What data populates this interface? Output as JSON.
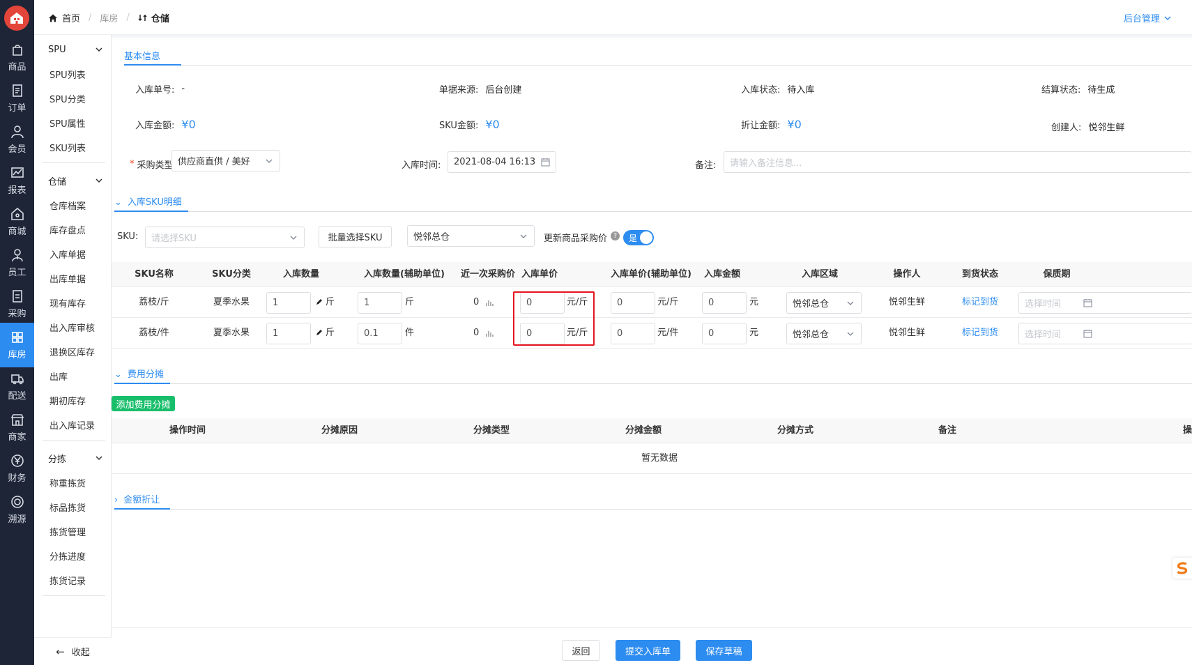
{
  "rail": [
    {
      "label": "商品",
      "icon": "bag-icon"
    },
    {
      "label": "订单",
      "icon": "order-icon"
    },
    {
      "label": "会员",
      "icon": "user-icon"
    },
    {
      "label": "报表",
      "icon": "chart-icon"
    },
    {
      "label": "商城",
      "icon": "home-icon"
    },
    {
      "label": "员工",
      "icon": "staff-icon"
    },
    {
      "label": "采购",
      "icon": "purchase-icon"
    },
    {
      "label": "库房",
      "icon": "warehouse-icon"
    },
    {
      "label": "配送",
      "icon": "truck-icon"
    },
    {
      "label": "商家",
      "icon": "shop-icon"
    },
    {
      "label": "财务",
      "icon": "yuan-icon"
    },
    {
      "label": "溯源",
      "icon": "trace-icon"
    }
  ],
  "submenu": {
    "groups": [
      {
        "label": "SPU",
        "items": [
          "SPU列表",
          "SPU分类",
          "SPU属性",
          "SKU列表"
        ]
      },
      {
        "label": "仓储",
        "items": [
          "仓库档案",
          "库存盘点",
          "入库单据",
          "出库单据",
          "现有库存",
          "出入库审核",
          "退换区库存",
          "出库",
          "期初库存",
          "出入库记录"
        ]
      },
      {
        "label": "分拣",
        "items": [
          "称重拣货",
          "标品拣货",
          "拣货管理",
          "分拣进度",
          "拣货记录"
        ]
      }
    ],
    "collapse": "收起"
  },
  "breadcrumb": {
    "home": "首页",
    "mid": "库房",
    "current": "仓储"
  },
  "admin": "后台管理",
  "basic": {
    "tab": "基本信息",
    "fields": {
      "order_no": {
        "label": "入库单号:",
        "value": "-"
      },
      "source": {
        "label": "单据来源:",
        "value": "后台创建"
      },
      "status": {
        "label": "入库状态:",
        "value": "待入库"
      },
      "settle": {
        "label": "结算状态:",
        "value": "待生成"
      },
      "amount": {
        "label": "入库金额:",
        "value": "¥0"
      },
      "sku_amount": {
        "label": "SKU金额:",
        "value": "¥0"
      },
      "discount": {
        "label": "折让金额:",
        "value": "¥0"
      },
      "creator": {
        "label": "创建人:",
        "value": "悦邻生鲜"
      },
      "purchase_type": {
        "label": "采购类型:",
        "value": "供应商直供 / 美好"
      },
      "in_time": {
        "label": "入库时间:",
        "value": "2021-08-04 16:13"
      },
      "remark": {
        "label": "备注:",
        "placeholder": "请输入备注信息..."
      }
    }
  },
  "sku": {
    "tab": "入库SKU明细",
    "label": "SKU:",
    "placeholder": "请选择SKU",
    "batch_btn": "批量选择SKU",
    "warehouse": "悦邻总仓",
    "update_price": "更新商品采购价",
    "switch": "是",
    "headers": [
      "SKU名称",
      "SKU分类",
      "入库数量",
      "入库数量(辅助单位)",
      "近一次采购价",
      "入库单价",
      "入库单价(辅助单位)",
      "入库金额",
      "入库区域",
      "操作人",
      "到货状态",
      "保质期"
    ],
    "rows": [
      {
        "name": "荔枝/斤",
        "category": "夏季水果",
        "qty": "1",
        "qty_unit": "斤",
        "aux_qty": "1",
        "aux_unit": "斤",
        "last_price": "0",
        "price": "0",
        "price_unit": "元/斤",
        "aux_price": "0",
        "aux_price_unit": "元/斤",
        "amount": "0",
        "amount_unit": "元",
        "area": "悦邻总仓",
        "operator": "悦邻生鲜",
        "arrival": "标记到货",
        "shelf": "选择时间"
      },
      {
        "name": "荔枝/件",
        "category": "夏季水果",
        "qty": "1",
        "qty_unit": "斤",
        "aux_qty": "0.1",
        "aux_unit": "件",
        "last_price": "0",
        "price": "0",
        "price_unit": "元/斤",
        "aux_price": "0",
        "aux_price_unit": "元/件",
        "amount": "0",
        "amount_unit": "元",
        "area": "悦邻总仓",
        "operator": "悦邻生鲜",
        "arrival": "标记到货",
        "shelf": "选择时间"
      }
    ]
  },
  "fee": {
    "tab": "费用分摊",
    "add_btn": "添加费用分摊",
    "headers": [
      "操作时间",
      "分摊原因",
      "分摊类型",
      "分摊金额",
      "分摊方式",
      "备注",
      "操"
    ],
    "empty": "暂无数据"
  },
  "discount_sec": {
    "tab": "金额折让"
  },
  "footer": {
    "back": "返回",
    "submit": "提交入库单",
    "draft": "保存草稿"
  },
  "colors": {
    "accent": "#2d8cf0",
    "rail_bg": "#1e2537",
    "green": "#19be6b",
    "highlight": "#e6141e"
  }
}
